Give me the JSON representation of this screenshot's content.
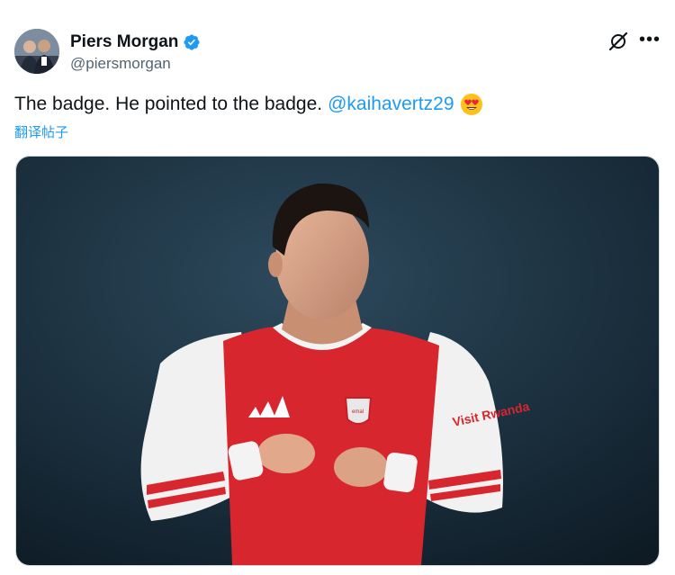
{
  "tweet": {
    "author": {
      "display_name": "Piers Morgan",
      "handle": "@piersmorgan",
      "verified": true
    },
    "text": "The badge. He pointed to the badge.",
    "mention": "@kaihavertz29",
    "emoji": "smiling-face-with-heart-eyes",
    "translate_label": "翻译帖子",
    "image": {
      "shirt_sponsor": "Visit Rwanda",
      "badge_sponsor": "emal"
    }
  },
  "icons": {
    "header_action": "grok-icon",
    "more": "more-icon"
  },
  "colors": {
    "accent": "#1d9bf0",
    "text": "#0f1419",
    "secondary_text": "#536471",
    "jersey_red": "#d7262e"
  }
}
